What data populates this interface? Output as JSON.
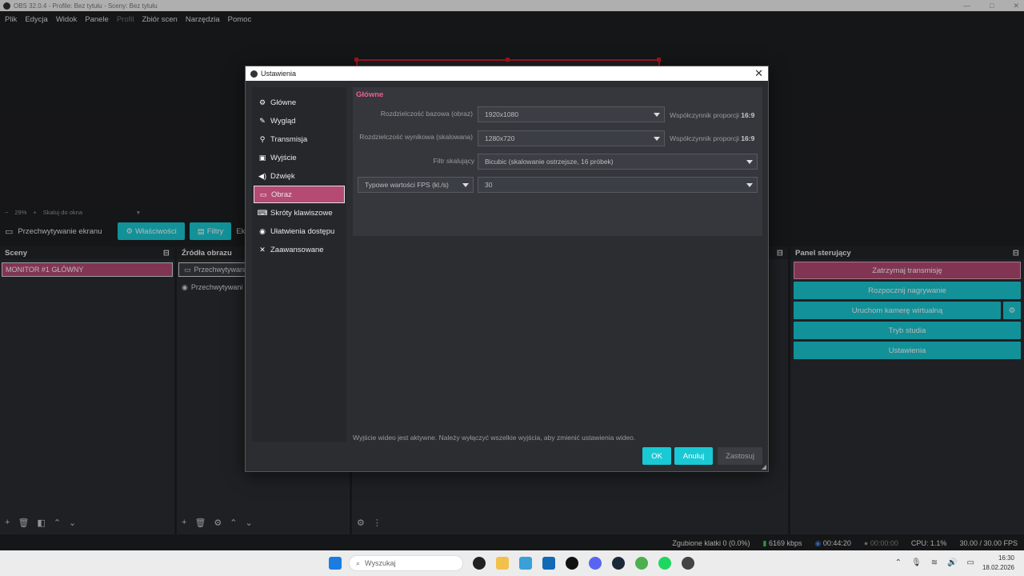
{
  "window": {
    "title": "OBS 32.0.4 - Profile: Bez tytułu - Sceny: Bez tytułu"
  },
  "menu": [
    "Plik",
    "Edycja",
    "Widok",
    "Panele",
    "Profil",
    "Zbiór scen",
    "Narzędzia",
    "Pomoc"
  ],
  "zoom": {
    "minus": "−",
    "value": "29%",
    "plus": "+",
    "label": "Skaluj do okna"
  },
  "source_toolbar": {
    "source_name": "Przechwytywanie ekranu",
    "properties_label": "Właściwości",
    "filters_label": "Filtry",
    "extra_label": "Ekra"
  },
  "scenes_dock": {
    "title": "Sceny",
    "items": [
      "MONITOR #1 GŁÓWNY"
    ]
  },
  "sources_dock": {
    "title": "Źródła obrazu",
    "items": [
      "Przechwytywani",
      "Przechwytywani"
    ]
  },
  "controls_dock": {
    "title": "Panel sterujący",
    "stop_stream": "Zatrzymaj transmisję",
    "start_recording": "Rozpocznij nagrywanie",
    "virtual_cam": "Uruchom kamerę wirtualną",
    "studio_mode": "Tryb studia",
    "settings": "Ustawienia"
  },
  "status": {
    "dropped_frames": "Zgubione klatki 0 (0.0%)",
    "bitrate": "6169 kbps",
    "stream_time": "00:44:20",
    "rec_time": "00:00:00",
    "cpu": "CPU: 1.1%",
    "fps": "30.00 / 30.00 FPS"
  },
  "taskbar": {
    "search_placeholder": "Wyszukaj",
    "time": "16:30",
    "date": "18.02.2026"
  },
  "dialog": {
    "title": "Ustawienia",
    "nav": [
      {
        "label": "Główne",
        "icon": "gear-icon"
      },
      {
        "label": "Wygląd",
        "icon": "brush-icon"
      },
      {
        "label": "Transmisja",
        "icon": "antenna-icon"
      },
      {
        "label": "Wyjście",
        "icon": "output-icon"
      },
      {
        "label": "Dźwięk",
        "icon": "speaker-icon"
      },
      {
        "label": "Obraz",
        "icon": "monitor-icon"
      },
      {
        "label": "Skróty klawiszowe",
        "icon": "keyboard-icon"
      },
      {
        "label": "Ułatwienia dostępu",
        "icon": "accessibility-icon"
      },
      {
        "label": "Zaawansowane",
        "icon": "tools-icon"
      }
    ],
    "active_nav": "Obraz",
    "section_title": "Główne",
    "base_res_label": "Rozdzielczość bazowa (obraz)",
    "base_res_value": "1920x1080",
    "base_ratio_label": "Współczynnik proporcji",
    "base_ratio_value": "16:9",
    "output_res_label": "Rozdzielczość wynikowa (skalowana)",
    "output_res_value": "1280x720",
    "output_ratio_label": "Współczynnik proporcji",
    "output_ratio_value": "16:9",
    "filter_label": "Filtr skalujący",
    "filter_value": "Bicubic (skalowanie ostrzejsze, 16 próbek)",
    "fps_type_value": "Typowe wartości FPS (kl./s)",
    "fps_value": "30",
    "warning": "Wyjście wideo jest aktywne. Należy wyłączyć wszelkie wyjścia, aby zmienić ustawienia wideo.",
    "ok": "OK",
    "cancel": "Anuluj",
    "apply": "Zastosuj"
  },
  "colors": {
    "accent_teal": "#19c9d4",
    "accent_pink": "#b54a72",
    "section_title": "#e8628e"
  }
}
